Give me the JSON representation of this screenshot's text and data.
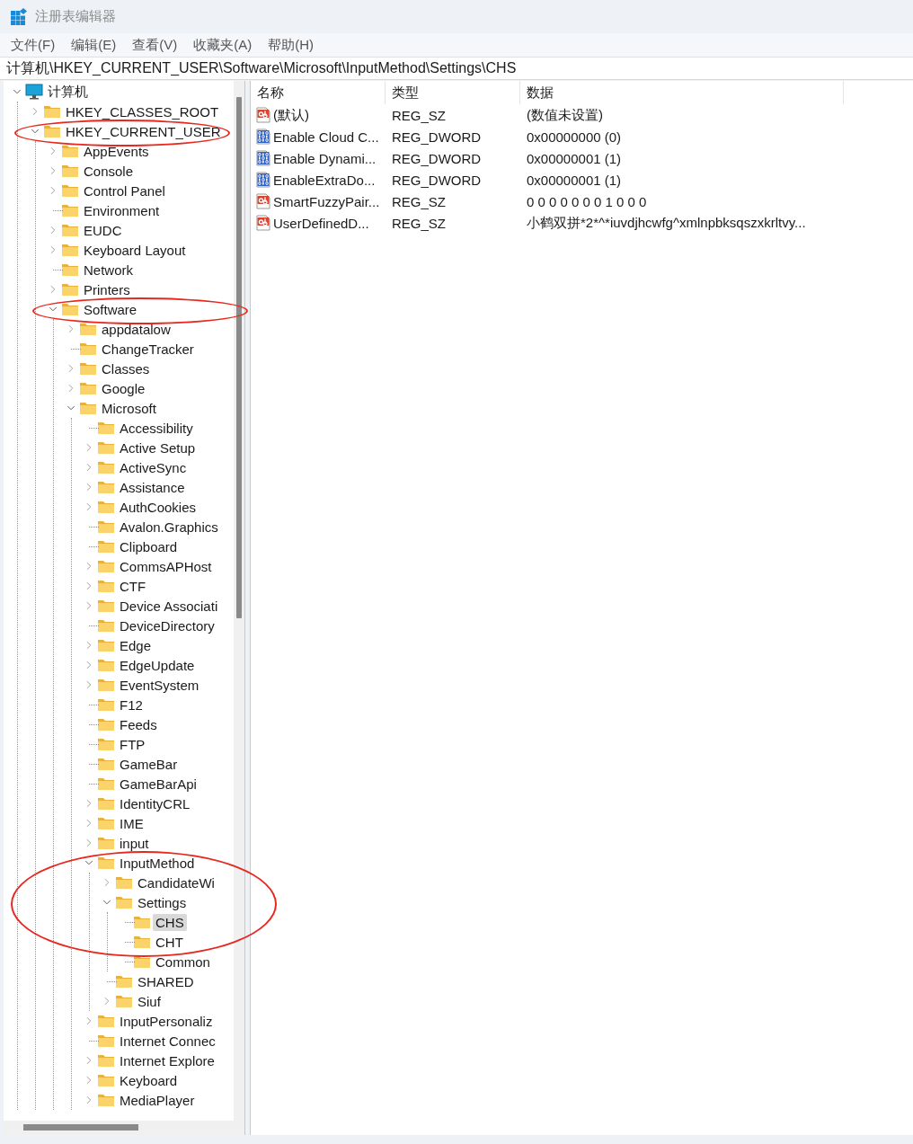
{
  "window": {
    "title": "注册表编辑器"
  },
  "menu": [
    "文件(F)",
    "编辑(E)",
    "查看(V)",
    "收藏夹(A)",
    "帮助(H)"
  ],
  "address": "计算机\\HKEY_CURRENT_USER\\Software\\Microsoft\\InputMethod\\Settings\\CHS",
  "tree": [
    {
      "label": "计算机",
      "kind": "computer",
      "expandable": true,
      "expanded": true,
      "selected": false,
      "children": [
        {
          "label": "HKEY_CLASSES_ROOT",
          "kind": "folder",
          "expandable": true,
          "expanded": false,
          "selected": false
        },
        {
          "label": "HKEY_CURRENT_USER",
          "kind": "folder",
          "expandable": true,
          "expanded": true,
          "selected": false,
          "circled": true,
          "children": [
            {
              "label": "AppEvents",
              "kind": "folder",
              "expandable": true,
              "expanded": false,
              "selected": false
            },
            {
              "label": "Console",
              "kind": "folder",
              "expandable": true,
              "expanded": false,
              "selected": false
            },
            {
              "label": "Control Panel",
              "kind": "folder",
              "expandable": true,
              "expanded": false,
              "selected": false
            },
            {
              "label": "Environment",
              "kind": "folder",
              "expandable": false,
              "selected": false
            },
            {
              "label": "EUDC",
              "kind": "folder",
              "expandable": true,
              "expanded": false,
              "selected": false
            },
            {
              "label": "Keyboard Layout",
              "kind": "folder",
              "expandable": true,
              "expanded": false,
              "selected": false
            },
            {
              "label": "Network",
              "kind": "folder",
              "expandable": false,
              "selected": false
            },
            {
              "label": "Printers",
              "kind": "folder",
              "expandable": true,
              "expanded": false,
              "selected": false
            },
            {
              "label": "Software",
              "kind": "folder",
              "expandable": true,
              "expanded": true,
              "selected": false,
              "circled": true,
              "children": [
                {
                  "label": "appdatalow",
                  "kind": "folder",
                  "expandable": true,
                  "expanded": false,
                  "selected": false
                },
                {
                  "label": "ChangeTracker",
                  "kind": "folder",
                  "expandable": false,
                  "selected": false
                },
                {
                  "label": "Classes",
                  "kind": "folder",
                  "expandable": true,
                  "expanded": false,
                  "selected": false
                },
                {
                  "label": "Google",
                  "kind": "folder",
                  "expandable": true,
                  "expanded": false,
                  "selected": false
                },
                {
                  "label": "Microsoft",
                  "kind": "folder",
                  "expandable": true,
                  "expanded": true,
                  "selected": false,
                  "children": [
                    {
                      "label": "Accessibility",
                      "kind": "folder",
                      "expandable": false,
                      "selected": false
                    },
                    {
                      "label": "Active Setup",
                      "kind": "folder",
                      "expandable": true,
                      "expanded": false,
                      "selected": false
                    },
                    {
                      "label": "ActiveSync",
                      "kind": "folder",
                      "expandable": true,
                      "expanded": false,
                      "selected": false
                    },
                    {
                      "label": "Assistance",
                      "kind": "folder",
                      "expandable": true,
                      "expanded": false,
                      "selected": false
                    },
                    {
                      "label": "AuthCookies",
                      "kind": "folder",
                      "expandable": true,
                      "expanded": false,
                      "selected": false
                    },
                    {
                      "label": "Avalon.Graphics",
                      "kind": "folder",
                      "expandable": false,
                      "selected": false
                    },
                    {
                      "label": "Clipboard",
                      "kind": "folder",
                      "expandable": false,
                      "selected": false
                    },
                    {
                      "label": "CommsAPHost",
                      "kind": "folder",
                      "expandable": true,
                      "expanded": false,
                      "selected": false
                    },
                    {
                      "label": "CTF",
                      "kind": "folder",
                      "expandable": true,
                      "expanded": false,
                      "selected": false
                    },
                    {
                      "label": "Device Associati",
                      "kind": "folder",
                      "expandable": true,
                      "expanded": false,
                      "selected": false
                    },
                    {
                      "label": "DeviceDirectory",
                      "kind": "folder",
                      "expandable": false,
                      "selected": false
                    },
                    {
                      "label": "Edge",
                      "kind": "folder",
                      "expandable": true,
                      "expanded": false,
                      "selected": false
                    },
                    {
                      "label": "EdgeUpdate",
                      "kind": "folder",
                      "expandable": true,
                      "expanded": false,
                      "selected": false
                    },
                    {
                      "label": "EventSystem",
                      "kind": "folder",
                      "expandable": true,
                      "expanded": false,
                      "selected": false
                    },
                    {
                      "label": "F12",
                      "kind": "folder",
                      "expandable": false,
                      "selected": false
                    },
                    {
                      "label": "Feeds",
                      "kind": "folder",
                      "expandable": false,
                      "selected": false
                    },
                    {
                      "label": "FTP",
                      "kind": "folder",
                      "expandable": false,
                      "selected": false
                    },
                    {
                      "label": "GameBar",
                      "kind": "folder",
                      "expandable": false,
                      "selected": false
                    },
                    {
                      "label": "GameBarApi",
                      "kind": "folder",
                      "expandable": false,
                      "selected": false
                    },
                    {
                      "label": "IdentityCRL",
                      "kind": "folder",
                      "expandable": true,
                      "expanded": false,
                      "selected": false
                    },
                    {
                      "label": "IME",
                      "kind": "folder",
                      "expandable": true,
                      "expanded": false,
                      "selected": false
                    },
                    {
                      "label": "input",
                      "kind": "folder",
                      "expandable": true,
                      "expanded": false,
                      "selected": false
                    },
                    {
                      "label": "InputMethod",
                      "kind": "folder",
                      "expandable": true,
                      "expanded": true,
                      "selected": false,
                      "children": [
                        {
                          "label": "CandidateWi",
                          "kind": "folder",
                          "expandable": true,
                          "expanded": false,
                          "selected": false
                        },
                        {
                          "label": "Settings",
                          "kind": "folder",
                          "expandable": true,
                          "expanded": true,
                          "selected": false,
                          "group_circled": true,
                          "children": [
                            {
                              "label": "CHS",
                              "kind": "folder",
                              "expandable": false,
                              "selected": true
                            },
                            {
                              "label": "CHT",
                              "kind": "folder",
                              "expandable": false,
                              "selected": false
                            },
                            {
                              "label": "Common",
                              "kind": "folder",
                              "expandable": false,
                              "selected": false
                            }
                          ]
                        },
                        {
                          "label": "SHARED",
                          "kind": "folder",
                          "expandable": false,
                          "selected": false
                        },
                        {
                          "label": "Siuf",
                          "kind": "folder",
                          "expandable": true,
                          "expanded": false,
                          "selected": false
                        }
                      ]
                    },
                    {
                      "label": "InputPersonaliz",
                      "kind": "folder",
                      "expandable": true,
                      "expanded": false,
                      "selected": false
                    },
                    {
                      "label": "Internet Connec",
                      "kind": "folder",
                      "expandable": false,
                      "selected": false
                    },
                    {
                      "label": "Internet Explore",
                      "kind": "folder",
                      "expandable": true,
                      "expanded": false,
                      "selected": false
                    },
                    {
                      "label": "Keyboard",
                      "kind": "folder",
                      "expandable": true,
                      "expanded": false,
                      "selected": false
                    },
                    {
                      "label": "MediaPlayer",
                      "kind": "folder",
                      "expandable": true,
                      "expanded": false,
                      "selected": false
                    }
                  ]
                }
              ]
            }
          ]
        }
      ]
    }
  ],
  "table": {
    "columns": [
      "名称",
      "类型",
      "数据"
    ],
    "rows": [
      {
        "kind": "string",
        "name": "(默认)",
        "type": "REG_SZ",
        "data": "(数值未设置)"
      },
      {
        "kind": "binary",
        "name": "Enable Cloud C...",
        "type": "REG_DWORD",
        "data": "0x00000000 (0)"
      },
      {
        "kind": "binary",
        "name": "Enable Dynami...",
        "type": "REG_DWORD",
        "data": "0x00000001 (1)"
      },
      {
        "kind": "binary",
        "name": "EnableExtraDo...",
        "type": "REG_DWORD",
        "data": "0x00000001 (1)"
      },
      {
        "kind": "string",
        "name": "SmartFuzzyPair...",
        "type": "REG_SZ",
        "data": "0 0 0 0 0 0 0 1 0 0 0"
      },
      {
        "kind": "string",
        "name": "UserDefinedD...",
        "type": "REG_SZ",
        "data": "小鹤双拼*2*^*iuvdjhcwfg^xmlnpbksqszxkrltvy..."
      }
    ]
  }
}
